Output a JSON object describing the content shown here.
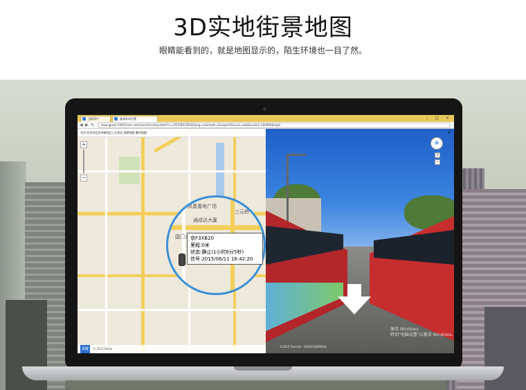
{
  "hero": {
    "title": "3D实地街景地图",
    "subtitle": "眼睛能看到的，就是地图显示的，陌生环境也一目了然。"
  },
  "browser": {
    "tabs": [
      {
        "label": "当前用户"
      },
      {
        "label": "查询实时位置"
      }
    ],
    "url": "www.gpsoo.10010care.com/user/tracking.shtml?v=20150610393&lang=cn&mode=&requestSource=web&custid=100000&login...",
    "window_buttons": "– □ ×"
  },
  "map": {
    "toolbar_text": "北京·北京市北京市朝阳区三元桥北 高德地图 腾讯地图",
    "tooltip": {
      "line1": "京F3XB20",
      "line2": "里程:0米",
      "line3": "状态:静止(1小时6分5秒)",
      "line4": "信号:2015/06/11 16:42:20"
    },
    "labels": {
      "landmark": "凤凰置地广场",
      "sanyuan": "三元桥",
      "tongcheng": "通成达大厦",
      "gate": "国门大"
    },
    "zoom_in": "+",
    "zoom_out": "−",
    "footer_logo": "百度",
    "footer_text": "© 2015 Baidu"
  },
  "street": {
    "compass": "✥",
    "zoom_in": "+",
    "zoom_out": "−",
    "close": "×",
    "watermark_line1": "激活 Windows",
    "watermark_line2": "转到\"电脑设置\"以激活 Windows。",
    "credit": "©2015 Tencent · GS(2014)6044号"
  }
}
